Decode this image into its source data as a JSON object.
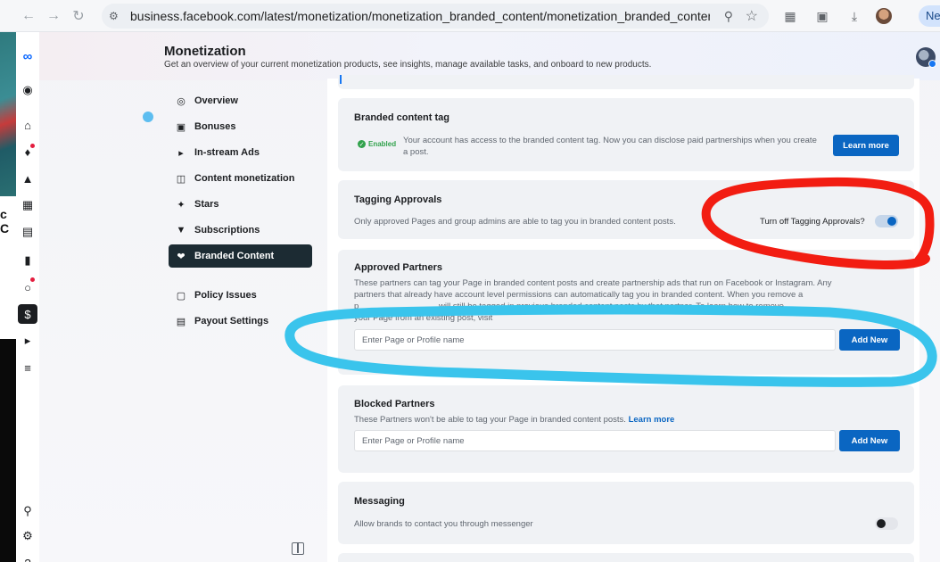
{
  "browser": {
    "url": "business.facebook.com/latest/monetization/monetization_branded_content/monetization_branded_content_setti...",
    "profile_tab_text": "Ne"
  },
  "left_strip": {
    "text": "c C"
  },
  "header": {
    "title": "Monetization",
    "subtitle": "Get an overview of your current monetization products, see insights, manage available tasks, and onboard to new products."
  },
  "sidebar": {
    "items": [
      {
        "label": "Overview",
        "icon": "overview-icon"
      },
      {
        "label": "Bonuses",
        "icon": "gift-icon"
      },
      {
        "label": "In-stream Ads",
        "icon": "megaphone-icon"
      },
      {
        "label": "Content monetization",
        "icon": "content-icon"
      },
      {
        "label": "Stars",
        "icon": "star-icon"
      },
      {
        "label": "Subscriptions",
        "icon": "shield-icon"
      },
      {
        "label": "Branded Content",
        "icon": "handshake-icon",
        "active": true
      },
      {
        "label": "Policy Issues",
        "icon": "policy-icon"
      },
      {
        "label": "Payout Settings",
        "icon": "bank-icon"
      }
    ]
  },
  "branded_tag": {
    "title": "Branded content tag",
    "status": "Enabled",
    "description": "Your account has access to the branded content tag. Now you can disclose paid partnerships when you create a post.",
    "button": "Learn more"
  },
  "tagging_approvals": {
    "title": "Tagging Approvals",
    "description": "Only approved Pages and group admins are able to tag you in branded content posts.",
    "toggle_label": "Turn off Tagging Approvals?",
    "toggle_on": true
  },
  "approved_partners": {
    "title": "Approved Partners",
    "line1": "These partners can tag your Page in branded content posts and create partnership ads that run on Facebook or Instagram. Any",
    "line2": "partners that already have account level permissions can automatically tag you in branded content. When you remove a",
    "line3": "p                                  will still be tagged in previous branded content posts by that partner. To learn how to remove",
    "line4": "your Page from an existing post, visit",
    "placeholder": "Enter Page or Profile name",
    "button": "Add New"
  },
  "blocked_partners": {
    "title": "Blocked Partners",
    "description": "These Partners won't be able to tag your Page in branded content posts.",
    "link": "Learn more",
    "placeholder": "Enter Page or Profile name",
    "button": "Add New"
  },
  "messaging": {
    "title": "Messaging",
    "description": "Allow brands to contact you through messenger",
    "toggle_on": false
  },
  "colors": {
    "primary_button": "#0a66c2",
    "active_nav": "#1c2b33",
    "annotation_red": "#f21d12",
    "annotation_blue": "#3ac4ec",
    "enabled_green": "#31a24c"
  }
}
